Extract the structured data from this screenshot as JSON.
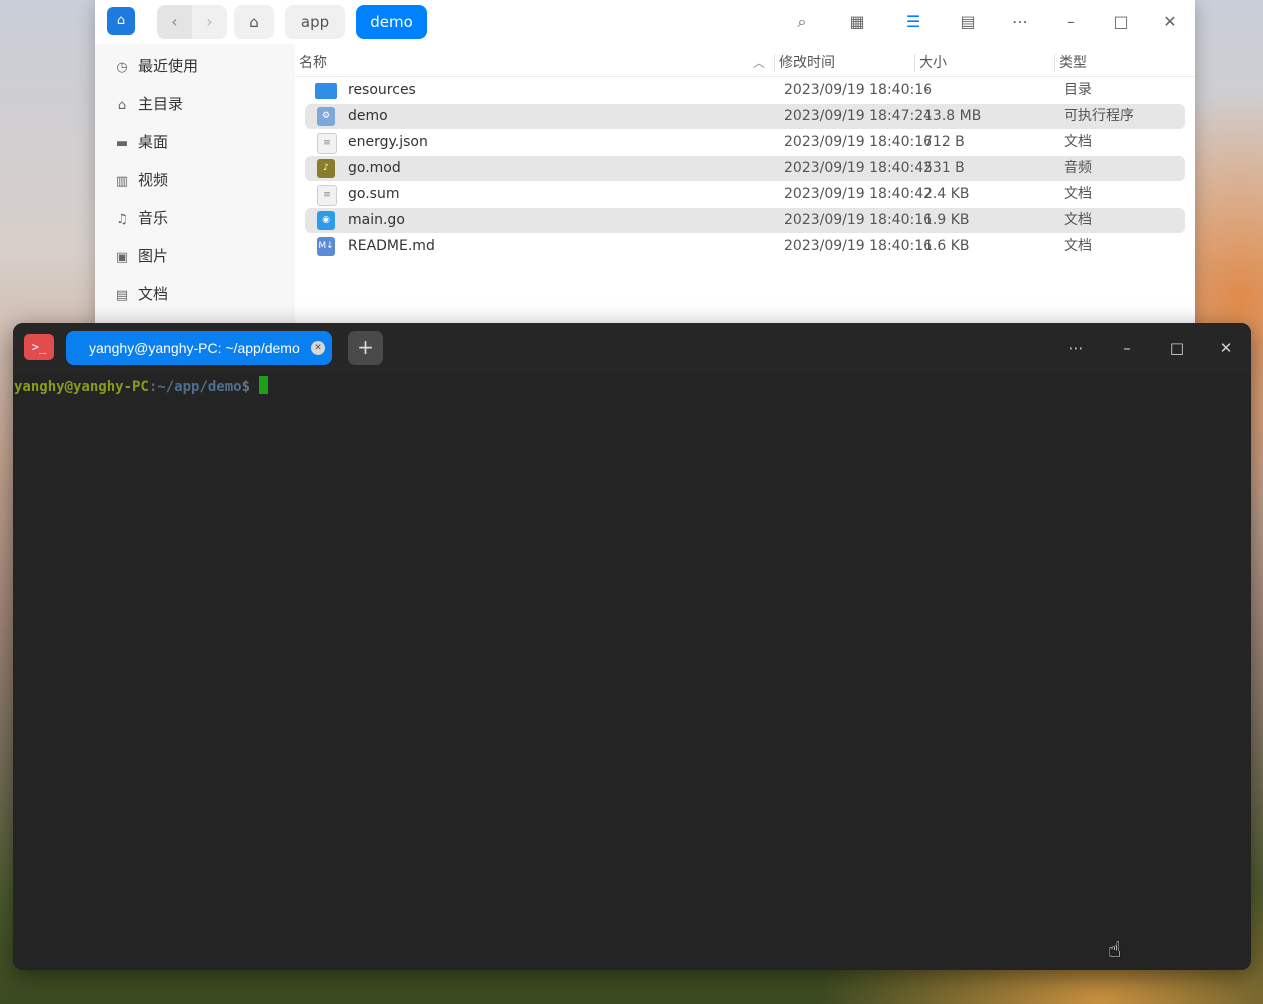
{
  "file_manager": {
    "breadcrumbs": [
      "app",
      "demo"
    ],
    "toolbar_icons": [
      "search-icon",
      "icon-view-icon",
      "list-view-icon",
      "detail-view-icon",
      "more-icon",
      "minimize-icon",
      "maximize-icon",
      "close-icon"
    ],
    "sidebar": [
      {
        "label": "最近使用",
        "icon": "clock-icon"
      },
      {
        "label": "主目录",
        "icon": "home-icon"
      },
      {
        "label": "桌面",
        "icon": "desktop-icon"
      },
      {
        "label": "视频",
        "icon": "video-icon"
      },
      {
        "label": "音乐",
        "icon": "music-icon"
      },
      {
        "label": "图片",
        "icon": "picture-icon"
      },
      {
        "label": "文档",
        "icon": "document-icon"
      }
    ],
    "columns": {
      "name": "名称",
      "modified": "修改时间",
      "size": "大小",
      "type": "类型"
    },
    "files": [
      {
        "name": "resources",
        "modified": "2023/09/19 18:40:16",
        "size": "-",
        "type": "目录",
        "icon": "folder-icon"
      },
      {
        "name": "demo",
        "modified": "2023/09/19 18:47:24",
        "size": "13.8 MB",
        "type": "可执行程序",
        "icon": "executable-icon"
      },
      {
        "name": "energy.json",
        "modified": "2023/09/19 18:40:16",
        "size": "712 B",
        "type": "文档",
        "icon": "text-file-icon"
      },
      {
        "name": "go.mod",
        "modified": "2023/09/19 18:40:42",
        "size": "531 B",
        "type": "音频",
        "icon": "audio-file-icon"
      },
      {
        "name": "go.sum",
        "modified": "2023/09/19 18:40:42",
        "size": "2.4 KB",
        "type": "文档",
        "icon": "text-file-icon"
      },
      {
        "name": "main.go",
        "modified": "2023/09/19 18:40:16",
        "size": "1.9 KB",
        "type": "文档",
        "icon": "go-file-icon"
      },
      {
        "name": "README.md",
        "modified": "2023/09/19 18:40:16",
        "size": "1.6 KB",
        "type": "文档",
        "icon": "markdown-file-icon"
      }
    ]
  },
  "terminal": {
    "tab_title": "yanghy@yanghy-PC: ~/app/demo",
    "prompt_user": "yanghy@yanghy-PC",
    "prompt_colon": ":",
    "prompt_path": "~/app/demo",
    "prompt_symbol": "$"
  },
  "colors": {
    "accent": "#0081ff",
    "terminal_bg": "#242424",
    "prompt_user": "#8a9b1e",
    "cursor": "#1ca01c"
  }
}
